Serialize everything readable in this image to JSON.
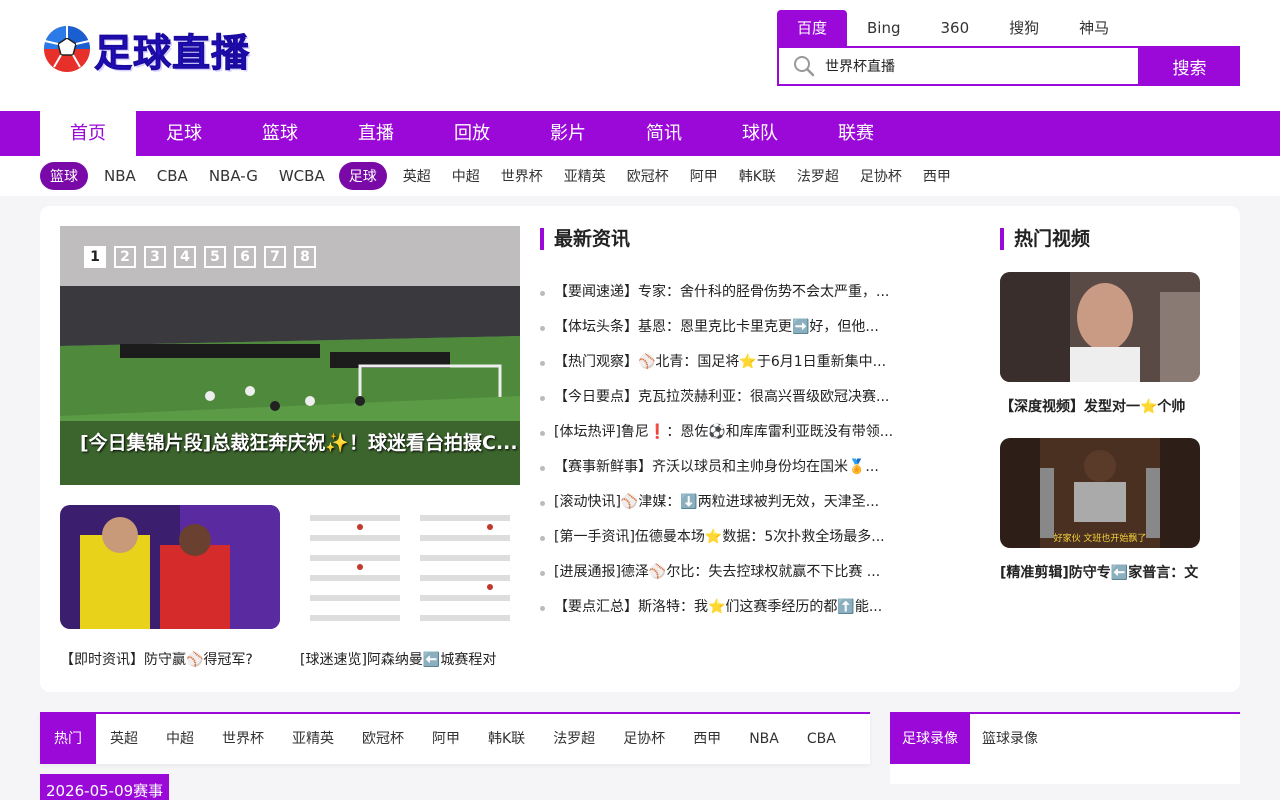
{
  "header": {
    "logo_text": "足球直播",
    "search_tabs": [
      "百度",
      "Bing",
      "360",
      "搜狗",
      "神马"
    ],
    "search_value": "世界杯直播",
    "search_button": "搜索"
  },
  "main_nav": [
    "首页",
    "足球",
    "篮球",
    "直播",
    "回放",
    "影片",
    "简讯",
    "球队",
    "联赛"
  ],
  "sub_nav": {
    "basketball_pill": "篮球",
    "basketball_items": [
      "NBA",
      "CBA",
      "NBA-G",
      "WCBA"
    ],
    "football_pill": "足球",
    "football_items": [
      "英超",
      "中超",
      "世界杯",
      "亚精英",
      "欧冠杯",
      "阿甲",
      "韩K联",
      "法罗超",
      "足协杯",
      "西甲"
    ]
  },
  "hero": {
    "pages": [
      "1",
      "2",
      "3",
      "4",
      "5",
      "6",
      "7",
      "8"
    ],
    "caption": "[今日集锦片段]总裁狂奔庆祝✨！球迷看台拍摄C..."
  },
  "thumbs": [
    {
      "caption": "【即时资讯】防守赢⚾得冠军?"
    },
    {
      "caption": "[球迷速览]阿森纳曼⬅️城赛程对"
    }
  ],
  "news": {
    "title": "最新资讯",
    "items": [
      "【要闻速递】专家：舍什科的胫骨伤势不会太严重，...",
      "【体坛头条】基恩：恩里克比卡里克更➡️好，但他...",
      "【热门观察】⚾北青：国足将⭐于6月1日重新集中...",
      "【今日要点】克瓦拉茨赫利亚：很高兴晋级欧冠决赛...",
      "[体坛热评]鲁尼❗：恩佐⚽和库库雷利亚既没有带领...",
      "【赛事新鲜事】齐沃以球员和主帅身份均在国米🏅...",
      "[滚动快讯]⚾津媒：⬇️两粒进球被判无效，天津圣...",
      "[第一手资讯]伍德曼本场⭐数据：5次扑救全场最多...",
      "[进展通报]德泽⚾尔比：失去控球权就赢不下比赛 ...",
      "【要点汇总】斯洛特：我⭐们这赛季经历的都⬆️能..."
    ]
  },
  "hot_videos": {
    "title": "热门视频",
    "items": [
      {
        "caption": "【深度视频】发型对一⭐个帅"
      },
      {
        "caption": "[精准剪辑]防守专⬅️家普言：文"
      }
    ],
    "video2_subtitle": "好家伙 文班也开始飘了"
  },
  "bottom_tabs": [
    "热门",
    "英超",
    "中超",
    "世界杯",
    "亚精英",
    "欧冠杯",
    "阿甲",
    "韩K联",
    "法罗超",
    "足协杯",
    "西甲",
    "NBA",
    "CBA"
  ],
  "date_tag": "2026-05-09赛事",
  "record_tabs": [
    "足球录像",
    "篮球录像"
  ],
  "colors": {
    "accent": "#9b09d9",
    "logo": "#2a12d8"
  }
}
